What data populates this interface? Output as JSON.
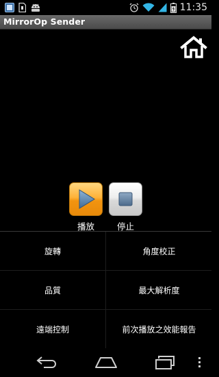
{
  "status_bar": {
    "time": "11:35",
    "left_icons": [
      "notification-app-icon",
      "sd-card-icon",
      "android-icon"
    ],
    "right_icons": [
      "alarm-icon",
      "wifi-icon",
      "signal-icon",
      "battery-icon"
    ]
  },
  "app": {
    "title": "MirrorOp Sender"
  },
  "header": {
    "home_icon": "home-icon"
  },
  "player": {
    "play_label": "播放",
    "stop_label": "停止",
    "play_color": "#f5a623",
    "stop_color": "#dcdcdc"
  },
  "menu": {
    "items": [
      {
        "label": "旋轉"
      },
      {
        "label": "角度校正"
      },
      {
        "label": "品質"
      },
      {
        "label": "最大解析度"
      },
      {
        "label": "遠端控制"
      },
      {
        "label": "前次播放之效能報告"
      }
    ]
  },
  "nav_bar": {
    "icons": [
      "back-icon",
      "home-nav-icon",
      "recent-apps-icon",
      "overflow-menu-icon"
    ]
  }
}
